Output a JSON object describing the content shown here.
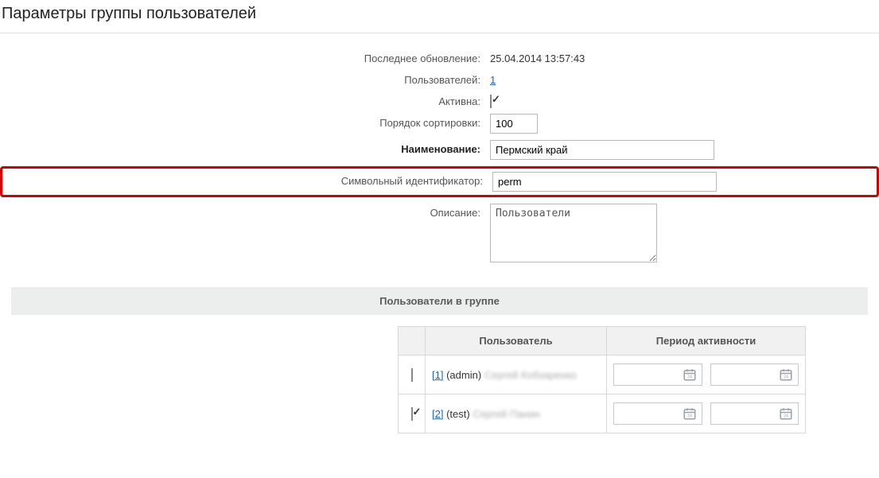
{
  "title": "Параметры группы пользователей",
  "form": {
    "last_update_label": "Последнее обновление:",
    "last_update_value": "25.04.2014 13:57:43",
    "users_label": "Пользователей:",
    "users_value": "1",
    "active_label": "Активна:",
    "active_checked": true,
    "sort_label": "Порядок сортировки:",
    "sort_value": "100",
    "name_label": "Наименование:",
    "name_value": "Пермский край",
    "ident_label": "Символьный идентификатор:",
    "ident_value": "perm",
    "desc_label": "Описание:",
    "desc_value": "Пользователи"
  },
  "members": {
    "heading": "Пользователи в группе",
    "col_user": "Пользователь",
    "col_period": "Период активности",
    "rows": [
      {
        "checked": false,
        "id_link": "[1]",
        "login": "(admin)",
        "name_obscured": "Сергей Кобзаренко"
      },
      {
        "checked": true,
        "id_link": "[2]",
        "login": "(test)",
        "name_obscured": "Сергей Панин"
      }
    ]
  }
}
